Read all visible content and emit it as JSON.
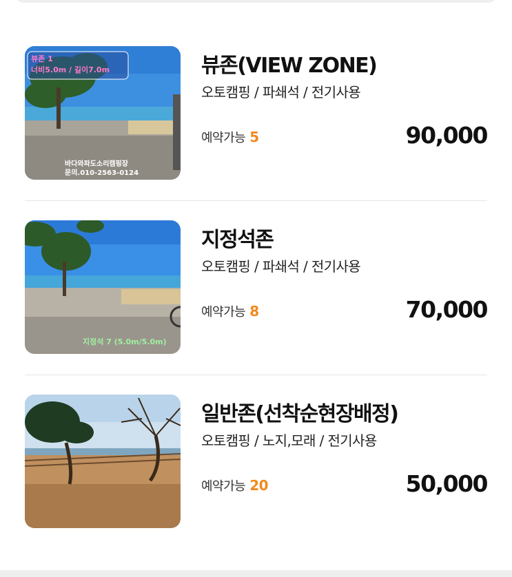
{
  "sites": [
    {
      "name": "뷰존(VIEW ZONE)",
      "features": "오토캠핑 / 파쇄석 / 전기사용",
      "availability_label": "예약가능",
      "availability_count": "5",
      "price": "90,000",
      "image_caption_line1": "뷰존 1",
      "image_caption_line2": "너비5.0m / 길이7.0m",
      "image_caption_footer1": "바다와파도소리캠핑장",
      "image_caption_footer2": "문의.010-2563-0124"
    },
    {
      "name": "지정석존",
      "features": "오토캠핑 / 파쇄석 / 전기사용",
      "availability_label": "예약가능",
      "availability_count": "8",
      "price": "70,000",
      "image_caption": "지정석 7 (5.0m/5.0m)"
    },
    {
      "name": "일반존(선착순현장배정)",
      "features": "오토캠핑 / 노지,모래 / 전기사용",
      "availability_label": "예약가능",
      "availability_count": "20",
      "price": "50,000"
    }
  ],
  "colors": {
    "accent_count": "#f28a1d",
    "divider": "#e6e6e6"
  }
}
